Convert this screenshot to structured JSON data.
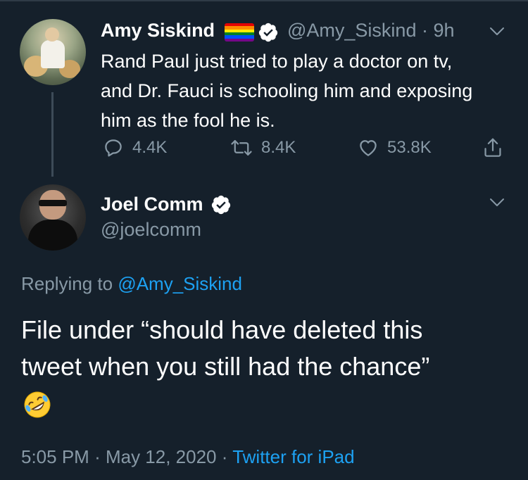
{
  "colors": {
    "background": "#15202b",
    "secondary_text": "#8899a6",
    "link": "#1da1f2",
    "verified_badge": "#ffffff"
  },
  "parent_tweet": {
    "display_name": "Amy Siskind",
    "handle": "@Amy_Siskind",
    "time": "9h",
    "separator": "·",
    "text_lines": [
      "Rand Paul just tried to play a doctor on tv,",
      "and Dr. Fauci is schooling him and exposing",
      "him as the fool he is."
    ],
    "replies": "4.4K",
    "retweets": "8.4K",
    "likes": "53.8K",
    "icons": {
      "flag": "rainbow-flag-icon",
      "verified": "verified-badge-icon",
      "menu": "chevron-down-icon",
      "reply": "reply-icon",
      "retweet": "retweet-icon",
      "like": "heart-icon",
      "share": "share-icon"
    }
  },
  "reply_tweet": {
    "display_name": "Joel Comm",
    "handle": "@joelcomm",
    "replying_prefix": "Replying to",
    "replying_to": "@Amy_Siskind",
    "text_lines": [
      "File under “should have deleted this",
      "tweet when you still had the chance”"
    ],
    "emoji": "rolling-on-floor-laughing-emoji",
    "time": "5:05 PM",
    "date": "May 12, 2020",
    "separator": "·",
    "source": "Twitter for iPad"
  }
}
